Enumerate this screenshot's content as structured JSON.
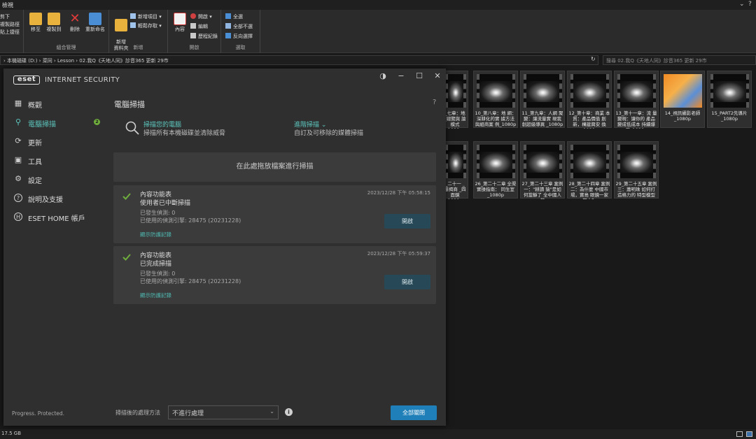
{
  "explorer": {
    "title": "檢視",
    "ribbon": {
      "clipboard_items": [
        "剪下",
        "複製路徑",
        "貼上捷徑"
      ],
      "organize": {
        "label": "組合管理",
        "move": "移至",
        "copy": "複製到",
        "delete": "刪除",
        "rename": "重新命名"
      },
      "new": {
        "label": "新增",
        "new_folder": "新增\n資料夾",
        "new_item": "新增項目 ▾",
        "easy_access": "輕鬆存取 ▾"
      },
      "open": {
        "label": "開啟",
        "properties": "內容",
        "open": "開啟 ▾",
        "edit": "編輯",
        "history": "歷程紀錄"
      },
      "select": {
        "label": "選取",
        "select_all": "全選",
        "select_none": "全部不選",
        "invert": "反向選擇"
      }
    },
    "address": {
      "path": "›  本機磁碟 (D:)  ›  菜同  ›  Lesson  ›  02.我Q《天地人同》診音365 更新 29市",
      "search_placeholder": "搜尋 02.我Q《天地人同》診音365 更新 29市"
    },
    "thumbnails": [
      {
        "caption": "_七章：地 _總覽與 論模式 1080p",
        "type": "video"
      },
      {
        "caption": "10_第八章：地 網：深耕化的實 據方法與組商案 例_1080p",
        "type": "video"
      },
      {
        "caption": "11_第九章：人網 聚變：讓流量實 現我創超級導異 _1080p",
        "type": "video"
      },
      {
        "caption": "12_第十章：商業 本質：產品價值 創新，構建興安 換_1080p",
        "type": "video"
      },
      {
        "caption": "13_第十一章：流 量變現：讓你的 產品變成低成本 持續爆發_1080p",
        "type": "video"
      },
      {
        "caption": "14_視訊攝影老師 _1080p",
        "type": "image"
      },
      {
        "caption": "15_PART2先導片 _1080p",
        "type": "video"
      },
      {
        "caption": "_二十一 _爆揭商 _四面鏡 1080p",
        "type": "video"
      },
      {
        "caption": "26_第二十二章 全渠實操指南： 同生室_1080p",
        "type": "video"
      },
      {
        "caption": "27_第二十三章 案例一：\"耕讀 猿\"是如何當靜了 全中國人的",
        "type": "video"
      },
      {
        "caption": "28_第二十四章 案例二：為什麼 中國市場，寶島 眼鏡一家獨大？",
        "type": "video"
      },
      {
        "caption": "29_第二十五章 案例三：蕭明珠 如何打造格力的 特型模型",
        "type": "video"
      }
    ],
    "status": "17.5 GB"
  },
  "eset": {
    "brand": "eset",
    "product": "INTERNET SECURITY",
    "window_controls": {
      "theme": "◑",
      "minimize": "−",
      "maximize": "☐",
      "close": "✕"
    },
    "nav": [
      {
        "label": "概觀",
        "icon": "overview-icon",
        "glyph": "▦",
        "active": false,
        "badge": ""
      },
      {
        "label": "電腦掃描",
        "icon": "scan-icon",
        "glyph": "⚲",
        "active": true,
        "badge": "2"
      },
      {
        "label": "更新",
        "icon": "update-icon",
        "glyph": "⟳",
        "active": false,
        "badge": ""
      },
      {
        "label": "工具",
        "icon": "tools-icon",
        "glyph": "▣",
        "active": false,
        "badge": ""
      },
      {
        "label": "設定",
        "icon": "settings-icon",
        "glyph": "⚙",
        "active": false,
        "badge": ""
      },
      {
        "label": "說明及支援",
        "icon": "help-icon",
        "glyph": "?",
        "active": false,
        "badge": ""
      },
      {
        "label": "ESET HOME 帳戶",
        "icon": "eset-home-icon",
        "glyph": "H",
        "active": false,
        "badge": ""
      }
    ],
    "tagline": "Progress. Protected.",
    "page": {
      "title": "電腦掃描",
      "help": "?",
      "scan_computer_title": "掃描您的電腦",
      "scan_computer_sub": "掃描所有本機磁碟並清除威脅",
      "advanced_title": "進階掃描 ⌄",
      "advanced_sub": "自訂及可移除的媒體掃描",
      "dropzone": "在此處拖放檔案進行掃描",
      "scans": [
        {
          "line1": "內容功能表",
          "line2": "使用者已中斷掃描",
          "timestamp": "2023/12/28 下午 05:58:15",
          "detections": "已發生偵測: 0",
          "engine": "已使用的偵測引擎: 28475 (20231228)",
          "log": "顯示防護記錄",
          "button": "開啟"
        },
        {
          "line1": "內容功能表",
          "line2": "已完成掃描",
          "timestamp": "2023/12/28 下午 05:59:37",
          "detections": "已發生偵測: 0",
          "engine": "已使用的偵測引擎: 28475 (20231228)",
          "log": "顯示防護記錄",
          "button": "開啟"
        }
      ],
      "after_scan_label": "掃描後的處理方法",
      "after_scan_value": "不進行處理",
      "close_all": "全部關閉"
    },
    "colors": {
      "accent": "#5ec8c0",
      "primary_button": "#1f7fb8",
      "secondary_button": "#274957",
      "check": "#6fae3c"
    }
  }
}
